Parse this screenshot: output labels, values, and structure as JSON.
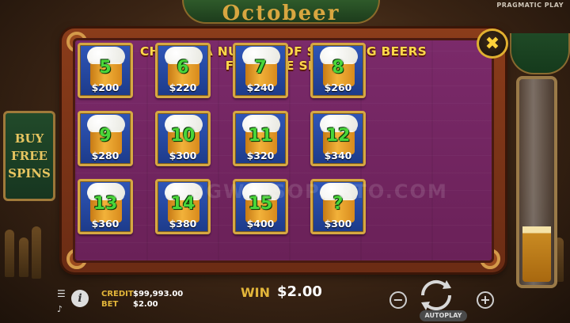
{
  "header": {
    "logo_text": "Octobeer",
    "brand": "PRAGMATIC PLAY"
  },
  "side": {
    "buy_free_spins": [
      "BUY",
      "FREE",
      "SPINS"
    ]
  },
  "dialog": {
    "title_line1": "CHOOSE A NUMBER OF STARTING BEERS",
    "title_line2": "FOR FREE SPINS",
    "close_icon": "close-x-icon",
    "options": [
      {
        "number": "5",
        "price": "$200"
      },
      {
        "number": "6",
        "price": "$220"
      },
      {
        "number": "7",
        "price": "$240"
      },
      {
        "number": "8",
        "price": "$260"
      },
      {
        "number": "9",
        "price": "$280"
      },
      {
        "number": "10",
        "price": "$300"
      },
      {
        "number": "11",
        "price": "$320"
      },
      {
        "number": "12",
        "price": "$340"
      },
      {
        "number": "13",
        "price": "$360"
      },
      {
        "number": "14",
        "price": "$380"
      },
      {
        "number": "15",
        "price": "$400"
      },
      {
        "number": "?",
        "price": "$300"
      }
    ]
  },
  "watermark": "BGWINSOPORTO.COM",
  "bottom_bar": {
    "credit_label": "CREDIT",
    "credit_value": "$99,993.00",
    "bet_label": "BET",
    "bet_value": "$2.00",
    "win_label": "WIN",
    "win_value": "$2.00",
    "autoplay_label": "AUTOPLAY",
    "minus_symbol": "−",
    "plus_symbol": "+",
    "info_symbol": "i"
  },
  "colors": {
    "title": "#ffd84a",
    "number": "#4ad63a",
    "tile": "#2f56b8",
    "frame": "#8a3c1a",
    "panel": "#7b2a6a"
  }
}
